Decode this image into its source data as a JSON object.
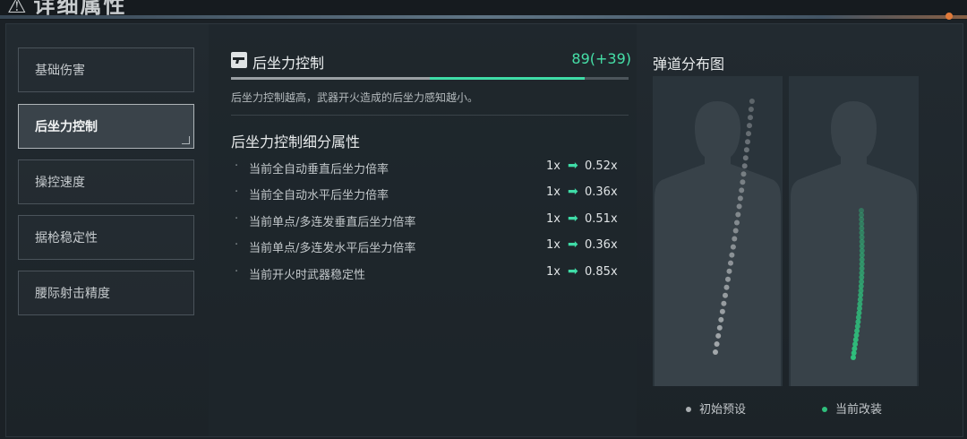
{
  "header": {
    "title": "详细属性"
  },
  "sidebar": {
    "items": [
      {
        "label": "基础伤害"
      },
      {
        "label": "后坐力控制"
      },
      {
        "label": "操控速度"
      },
      {
        "label": "据枪稳定性"
      },
      {
        "label": "腰际射击精度"
      }
    ],
    "active_index": 1
  },
  "detail": {
    "title": "后坐力控制",
    "value": "89(+39)",
    "progress": {
      "base_fraction": 0.5,
      "added_fraction": 0.39
    },
    "description": "后坐力控制越高，武器开火造成的后坐力感知越小。",
    "sub_title": "后坐力控制细分属性",
    "stats": [
      {
        "name": "当前全自动垂直后坐力倍率",
        "from": "1x",
        "to": "0.52x"
      },
      {
        "name": "当前全自动水平后坐力倍率",
        "from": "1x",
        "to": "0.36x"
      },
      {
        "name": "当前单点/多连发垂直后坐力倍率",
        "from": "1x",
        "to": "0.51x"
      },
      {
        "name": "当前单点/多连发水平后坐力倍率",
        "from": "1x",
        "to": "0.36x"
      },
      {
        "name": "当前开火时武器稳定性",
        "from": "1x",
        "to": "0.85x"
      }
    ],
    "bullet_glyph": "·",
    "arrow_glyph": "➡"
  },
  "chart": {
    "title": "弹道分布图",
    "legend": [
      {
        "label": "初始预设",
        "color": "#a9aeb1"
      },
      {
        "label": "当前改装",
        "color": "#2fbf7c"
      }
    ]
  },
  "colors": {
    "accent": "#3fdca7",
    "accent_dark": "#2fbf7c",
    "neutral_dot": "#a9aeb1"
  }
}
